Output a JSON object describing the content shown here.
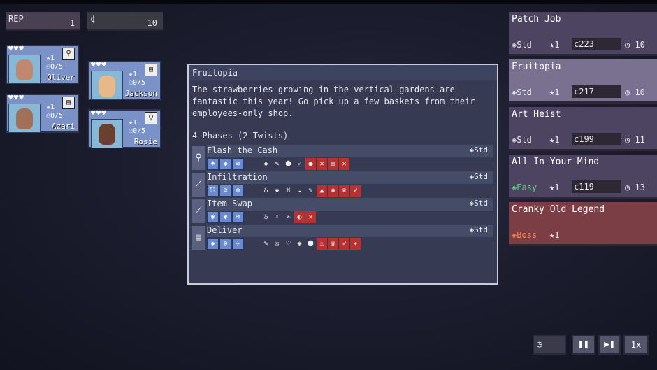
{
  "resources": {
    "rep_label": "REP",
    "rep_value": "1",
    "cash_label": "¢",
    "cash_value": "10"
  },
  "agents": [
    {
      "name": "Oliver",
      "hearts": "♥♥♥",
      "level": "★1",
      "xp": "⚇0/5",
      "type_icon": "lightbulb",
      "type_glyph": "⚲",
      "face_color": "#c08870"
    },
    {
      "name": "Jackson",
      "hearts": "♥♥♥",
      "level": "★1",
      "xp": "⚇0/5",
      "type_icon": "card",
      "type_glyph": "▤",
      "face_color": "#e8b888"
    },
    {
      "name": "Azari",
      "hearts": "♥♥♥",
      "level": "★1",
      "xp": "⚇0/5",
      "type_icon": "card",
      "type_glyph": "▤",
      "face_color": "#a07058"
    },
    {
      "name": "Rosie",
      "hearts": "♥♥♥",
      "level": "★1",
      "xp": "⚇0/5",
      "type_icon": "lightbulb",
      "type_glyph": "⚲",
      "face_color": "#6a4030"
    }
  ],
  "detail": {
    "title": "Fruitopia",
    "description": "The strawberries growing in the vertical gardens are fantastic this year! Go pick up a few baskets from their employees-only shop.",
    "phases_label": "4 Phases (2 Twists)",
    "phases": [
      {
        "name": "Flash the Cash",
        "tag": "◈Std",
        "icon": "lightbulb",
        "glyph": "⚲",
        "skills": [
          "♠",
          "✱",
          "≋"
        ],
        "reqs": [
          [
            "◆",
            false
          ],
          [
            "✎",
            false
          ],
          [
            "⬢",
            false
          ],
          [
            "➶",
            false
          ],
          [
            "●",
            true
          ],
          [
            "✕",
            true
          ],
          [
            "▤",
            true
          ],
          [
            "✕",
            true
          ]
        ]
      },
      {
        "name": "Infiltration",
        "tag": "◈Std",
        "icon": "feather",
        "glyph": "⟋",
        "skills": [
          "⤧",
          "≋",
          "⊗"
        ],
        "reqs": [
          [
            "ઠ",
            false
          ],
          [
            "✸",
            false
          ],
          [
            "⌘",
            false
          ],
          [
            "☁",
            false
          ],
          [
            "✎",
            false
          ],
          [
            "▲",
            true
          ],
          [
            "✺",
            true
          ],
          [
            "♛",
            true
          ],
          [
            "➹",
            true
          ]
        ]
      },
      {
        "name": "Item Swap",
        "tag": "◈Std",
        "icon": "feather",
        "glyph": "⟋",
        "skills": [
          "✱",
          "✱",
          "≋"
        ],
        "reqs": [
          [
            "ઠ",
            false
          ],
          [
            "◦",
            false
          ],
          [
            "✍",
            false
          ],
          [
            "◐",
            true
          ],
          [
            "✕",
            true
          ]
        ]
      },
      {
        "name": "Deliver",
        "tag": "◈Std",
        "icon": "card",
        "glyph": "▤",
        "skills": [
          "✸",
          "⊗",
          "✈"
        ],
        "reqs": [
          [
            "✎",
            false
          ],
          [
            "✉",
            false
          ],
          [
            "♡",
            false
          ],
          [
            "◈",
            false
          ],
          [
            "⬢",
            false
          ],
          [
            "♨",
            true
          ],
          [
            "♛",
            true
          ],
          [
            "➶",
            true
          ],
          [
            "✦",
            true
          ]
        ]
      }
    ]
  },
  "missions": [
    {
      "name": "Patch Job",
      "difficulty": "◈Std",
      "stars": "★1",
      "pay": "¢223",
      "time": "◷ 10",
      "variant": "normal"
    },
    {
      "name": "Fruitopia",
      "difficulty": "◈Std",
      "stars": "★1",
      "pay": "¢217",
      "time": "◷ 10",
      "variant": "selected"
    },
    {
      "name": "Art Heist",
      "difficulty": "◈Std",
      "stars": "★1",
      "pay": "¢199",
      "time": "◷ 11",
      "variant": "normal"
    },
    {
      "name": "All In Your Mind",
      "difficulty": "◈Easy",
      "stars": "★1",
      "pay": "¢119",
      "time": "◷ 13",
      "variant": "easy"
    },
    {
      "name": "Cranky Old Legend",
      "difficulty": "◈Boss",
      "stars": "★1",
      "pay": "",
      "time": "",
      "variant": "boss"
    }
  ],
  "controls": {
    "clock": "◷",
    "pause": "❚❚",
    "skip": "▶❚",
    "speed": "1x"
  }
}
